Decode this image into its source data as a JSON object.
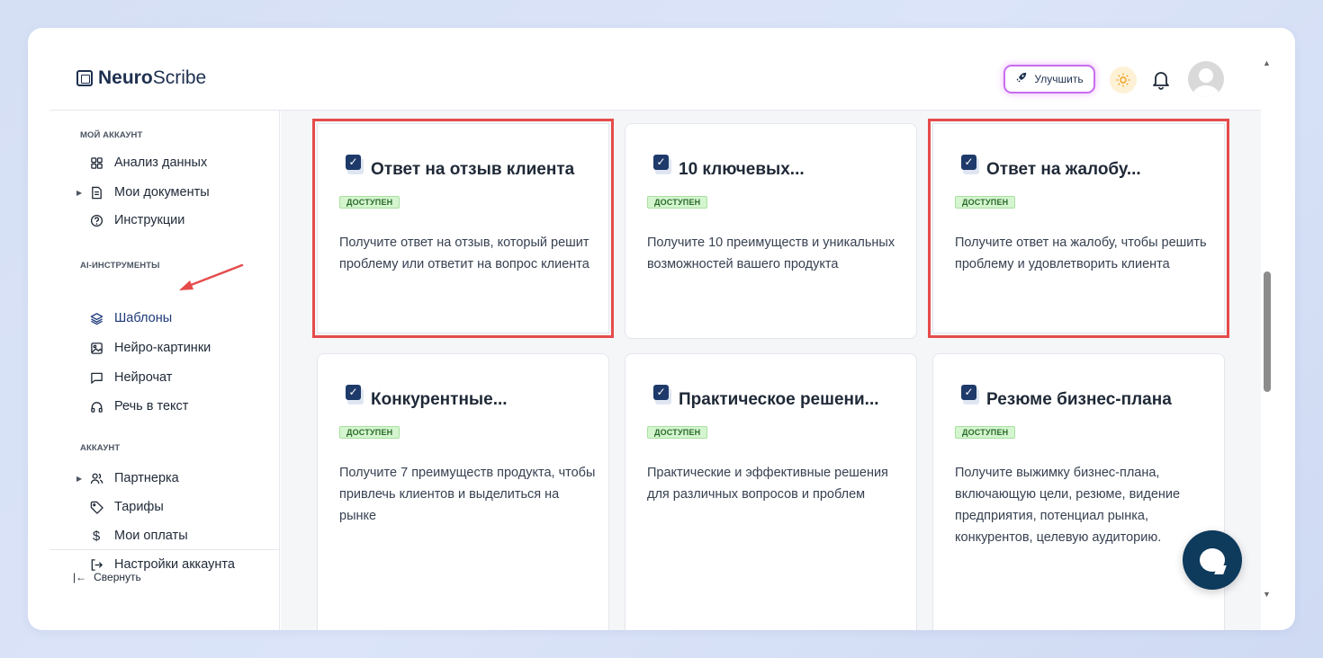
{
  "app": {
    "logo_bold": "Neuro",
    "logo_regular": "Scribe"
  },
  "header": {
    "upgrade_label": "Улучшить",
    "theme_icon": "sun-icon",
    "bell_icon": "bell-icon",
    "avatar_icon": "user-avatar"
  },
  "sidebar": {
    "sections": [
      {
        "title": "МОЙ АККАУНТ",
        "items": [
          {
            "label": "Анализ данных",
            "icon": "grid-icon",
            "expandable": false
          },
          {
            "label": "Мои документы",
            "icon": "document-icon",
            "expandable": true
          },
          {
            "label": "Инструкции",
            "icon": "help-circle-icon",
            "expandable": false
          }
        ]
      },
      {
        "title": "AI-ИНСТРУМЕНТЫ",
        "items": [
          {
            "label": "Шаблоны",
            "icon": "layers-icon",
            "expandable": false,
            "active": true
          },
          {
            "label": "Нейро-картинки",
            "icon": "image-icon",
            "expandable": false
          },
          {
            "label": "Нейрочат",
            "icon": "chat-icon",
            "expandable": false
          },
          {
            "label": "Речь в текст",
            "icon": "headphones-icon",
            "expandable": false
          }
        ]
      },
      {
        "title": "АККАУНТ",
        "items": [
          {
            "label": "Партнерка",
            "icon": "users-icon",
            "expandable": true
          },
          {
            "label": "Тарифы",
            "icon": "tag-icon",
            "expandable": false
          },
          {
            "label": "Мои оплаты",
            "icon": "dollar-icon",
            "expandable": false
          },
          {
            "label": "Настройки аккаунта",
            "icon": "logout-icon",
            "expandable": false
          }
        ]
      }
    ],
    "collapse_label": "Свернуть"
  },
  "templates": [
    {
      "title": "Ответ на отзыв клиента",
      "badge": "ДОСТУПЕН",
      "description": "Получите ответ на отзыв, который решит проблему или ответит на вопрос клиента",
      "highlighted": true
    },
    {
      "title": "10 ключевых...",
      "badge": "ДОСТУПЕН",
      "description": "Получите 10 преимуществ и уникальных возможностей вашего продукта",
      "highlighted": false
    },
    {
      "title": "Ответ на жалобу...",
      "badge": "ДОСТУПЕН",
      "description": "Получите ответ на жалобу, чтобы решить проблему и удовлетворить клиента",
      "highlighted": true
    },
    {
      "title": "Конкурентные...",
      "badge": "ДОСТУПЕН",
      "description": "Получите 7 преимуществ продукта, чтобы привлечь клиентов и выделиться на рынке",
      "highlighted": false
    },
    {
      "title": "Практическое решени...",
      "badge": "ДОСТУПЕН",
      "description": "Практические и эффективные решения для различных вопросов и проблем",
      "highlighted": false
    },
    {
      "title": "Резюме бизнес-плана",
      "badge": "ДОСТУПЕН",
      "description": "Получите выжимку бизнес-плана, включающую цели, резюме, видение предприятия, потенциал рынка, конкурентов, целевую аудиторию.",
      "highlighted": false
    }
  ],
  "colors": {
    "highlight": "#e64b4b",
    "badge_bg": "#d4f5cf",
    "chat_button": "#0e3a5c",
    "annotation_arrow": "#e64b4b"
  }
}
